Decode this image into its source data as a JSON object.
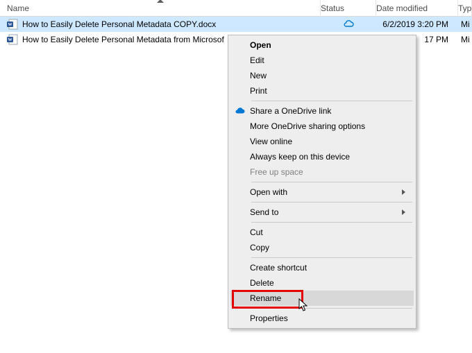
{
  "columns": {
    "name": "Name",
    "status": "Status",
    "date": "Date modified",
    "type": "Typ"
  },
  "rows": [
    {
      "name": "How to Easily Delete Personal Metadata COPY.docx",
      "date": "6/2/2019 3:20 PM",
      "type": "Mi",
      "selected": true,
      "status": "cloud"
    },
    {
      "name": "How to Easily Delete Personal Metadata from Microsof",
      "date": "17 PM",
      "type": "Mi",
      "selected": false,
      "status": ""
    }
  ],
  "menu": {
    "open": "Open",
    "edit": "Edit",
    "new": "New",
    "print": "Print",
    "share_onedrive": "Share a OneDrive link",
    "more_onedrive": "More OneDrive sharing options",
    "view_online": "View online",
    "always_keep": "Always keep on this device",
    "free_up": "Free up space",
    "open_with": "Open with",
    "send_to": "Send to",
    "cut": "Cut",
    "copy": "Copy",
    "create_shortcut": "Create shortcut",
    "delete": "Delete",
    "rename": "Rename",
    "properties": "Properties"
  }
}
